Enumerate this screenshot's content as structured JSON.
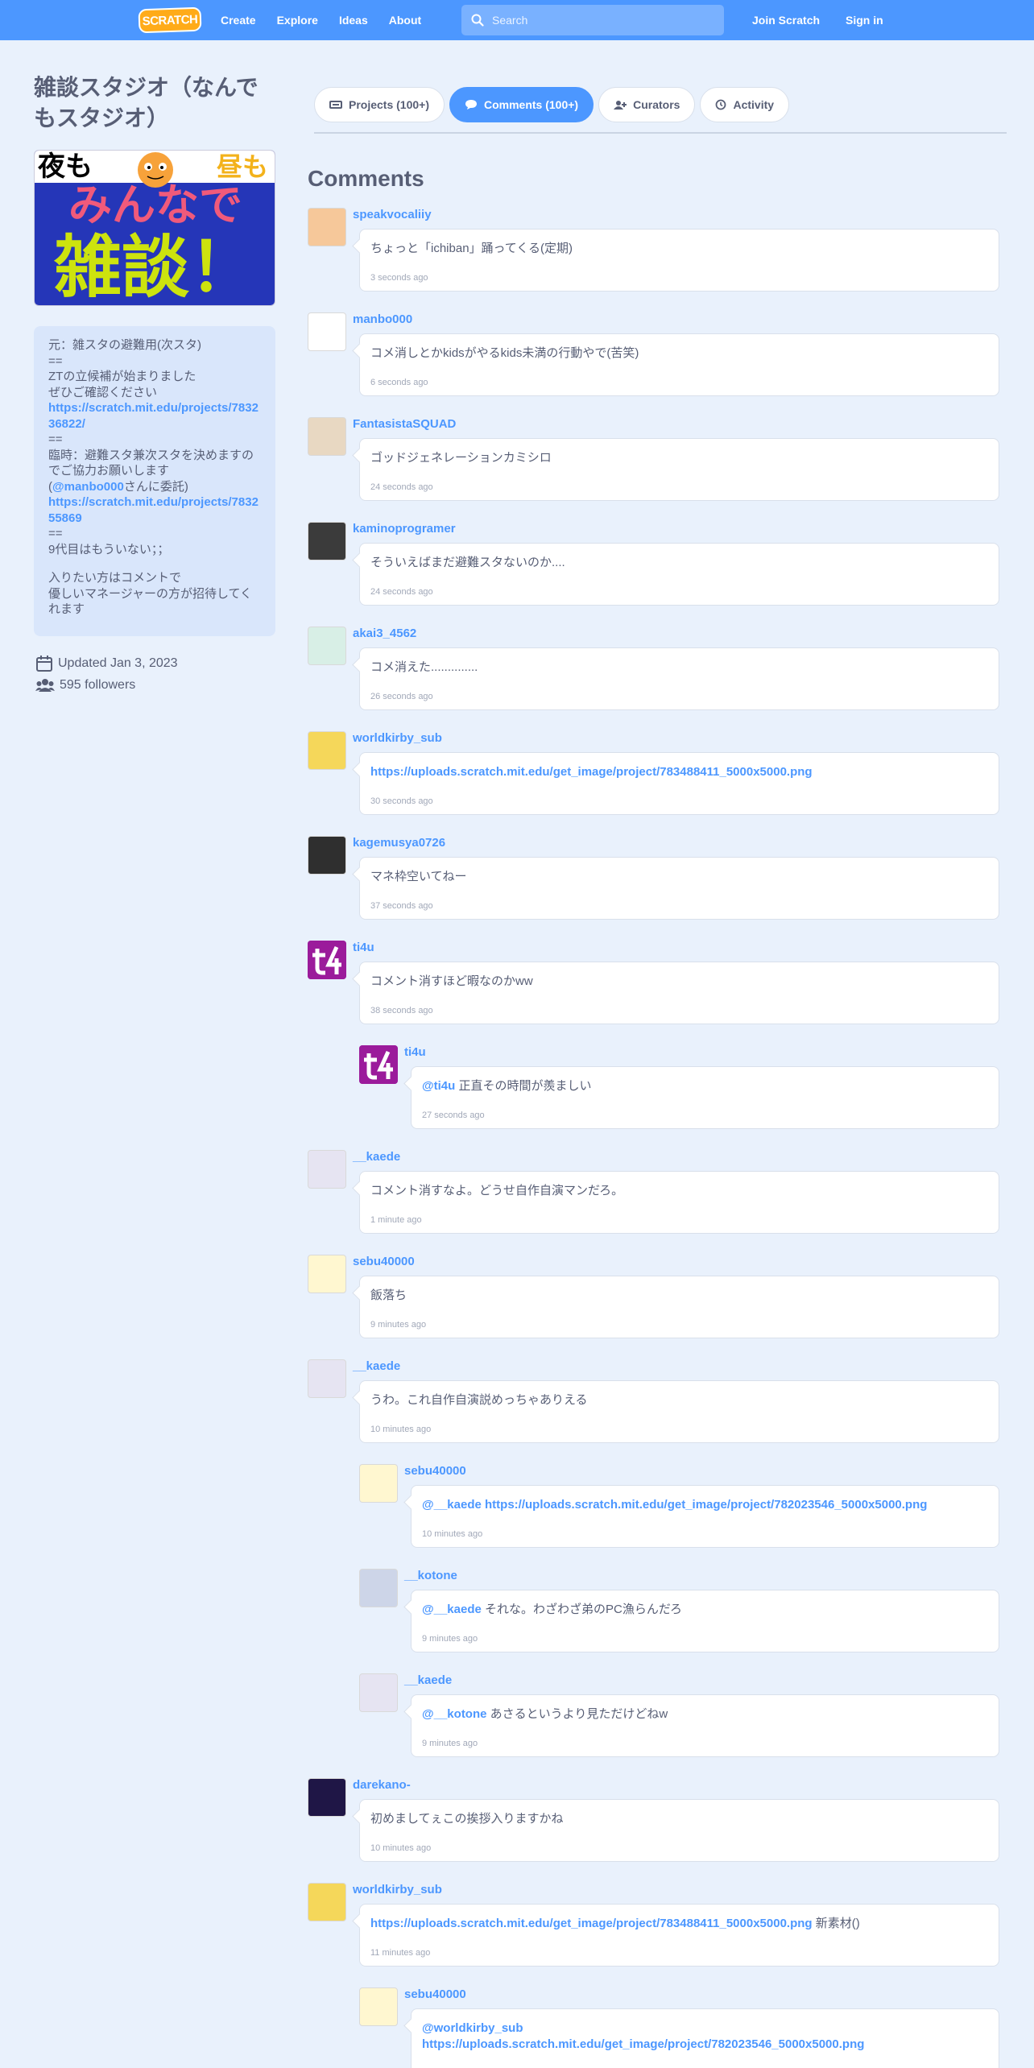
{
  "nav": {
    "logo": "SCRATCH",
    "links": [
      "Create",
      "Explore",
      "Ideas",
      "About"
    ],
    "search_placeholder": "Search",
    "join": "Join Scratch",
    "signin": "Sign in"
  },
  "studio": {
    "title": "雑談スタジオ（なんでもスタジオ）",
    "thumb_text": {
      "tl": "夜も",
      "tr": "昼も",
      "mid": "みんなで",
      "big": "雑談！"
    },
    "description": {
      "l1": "元：雑スタの避難用(次スタ)",
      "l2": "==",
      "l3": "ZTの立候補が始まりました",
      "l4": "ぜひご確認ください",
      "link1": "https://scratch.mit.edu/projects/783236822/",
      "l5": "==",
      "l6": "臨時：避難スタ兼次スタを決めますのでご協力お願いします",
      "l7a": "(",
      "mention": "@manbo000",
      "l7b": "さんに委託)",
      "link2": "https://scratch.mit.edu/projects/783255869",
      "l8": "==",
      "l9": "9代目はもういない；；",
      "l10": "入りたい方はコメントで",
      "l11": "優しいマネージャーの方が招待してくれます"
    },
    "updated": "Updated Jan 3, 2023",
    "followers": "595 followers"
  },
  "tabs": [
    {
      "label": "Projects (100+)"
    },
    {
      "label": "Comments (100+)"
    },
    {
      "label": "Curators"
    },
    {
      "label": "Activity"
    }
  ],
  "comments_heading": "Comments",
  "comments": [
    {
      "user": "speakvocaliiy",
      "text": "ちょっと「ichiban」踊ってくる(定期)",
      "time": "3 seconds ago"
    },
    {
      "user": "manbo000",
      "text": "コメ消しとかkidsがやるkids未満の行動やで(苦笑)",
      "time": "6 seconds ago"
    },
    {
      "user": "FantasistaSQUAD",
      "text": "ゴッドジェネレーションカミシロ",
      "time": "24 seconds ago"
    },
    {
      "user": "kaminoprogramer",
      "text": "そういえばまだ避難スタないのか....",
      "time": "24 seconds ago"
    },
    {
      "user": "akai3_4562",
      "text": "コメ消えた..............",
      "time": "26 seconds ago"
    },
    {
      "user": "worldkirby_sub",
      "link": "https://uploads.scratch.mit.edu/get_image/project/783488411_5000x5000.png",
      "time": "30 seconds ago"
    },
    {
      "user": "kagemusya0726",
      "text": "マネ枠空いてねー",
      "time": "37 seconds ago"
    },
    {
      "user": "ti4u",
      "text": "コメント消すほど暇なのかww",
      "time": "38 seconds ago"
    },
    {
      "user": "ti4u",
      "mention": "@ti4u",
      "text": " 正直その時間が羨ましい",
      "time": "27 seconds ago"
    },
    {
      "user": "__kaede",
      "text": "コメント消すなよ。どうせ自作自演マンだろ。",
      "time": "1 minute ago"
    },
    {
      "user": "sebu40000",
      "text": "飯落ち",
      "time": "9 minutes ago"
    },
    {
      "user": "__kaede",
      "text": "うわ。これ自作自演説めっちゃありえる",
      "time": "10 minutes ago"
    },
    {
      "user": "sebu40000",
      "mention": "@__kaede",
      "link": "https://uploads.scratch.mit.edu/get_image/project/782023546_5000x5000.png",
      "time": "10 minutes ago"
    },
    {
      "user": "__kotone",
      "mention": "@__kaede",
      "text": " それな。わざわざ弟のPC漁らんだろ",
      "time": "9 minutes ago"
    },
    {
      "user": "__kaede",
      "mention": "@__kotone",
      "text": " あさるというより見ただけどねw",
      "time": "9 minutes ago"
    },
    {
      "user": "darekano-",
      "text": "初めましてぇこの挨拶入りますかね",
      "time": "10 minutes ago"
    },
    {
      "user": "worldkirby_sub",
      "link": "https://uploads.scratch.mit.edu/get_image/project/783488411_5000x5000.png",
      "text": " 新素材()",
      "time": "11 minutes ago"
    },
    {
      "user": "sebu40000",
      "mention": "@worldkirby_sub",
      "link": "https://uploads.scratch.mit.edu/get_image/project/782023546_5000x5000.png",
      "time": ""
    }
  ]
}
